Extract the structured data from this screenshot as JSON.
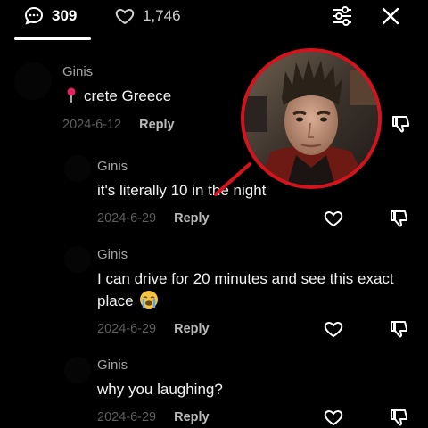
{
  "header": {
    "comments_count": "309",
    "likes_count": "1,746",
    "icons": [
      "comment-bubble-icon",
      "heart-icon",
      "sliders-icon",
      "close-icon"
    ]
  },
  "comments": [
    {
      "username": "Ginis",
      "text": "crete Greece",
      "has_pin": true,
      "date": "2024-6-12",
      "reply": "Reply"
    },
    {
      "username": "Ginis",
      "text": "it's literally 10 in the night",
      "date": "2024-6-29",
      "reply": "Reply"
    },
    {
      "username": "Ginis",
      "text": "I can drive for 20 minutes and see this exact place",
      "has_emoji": true,
      "emoji": "loudly-crying-face",
      "date": "2024-6-29",
      "reply": "Reply"
    },
    {
      "username": "Ginis",
      "text": "why you laughing?",
      "date": "2024-6-29",
      "reply": "Reply"
    }
  ],
  "overlay": {
    "type": "reaction-photo",
    "border_color": "#d3141d"
  },
  "colors": {
    "background": "#000000",
    "username": "#a3a3a3",
    "date": "#5e5e5e",
    "accent_red": "#d3141d"
  }
}
